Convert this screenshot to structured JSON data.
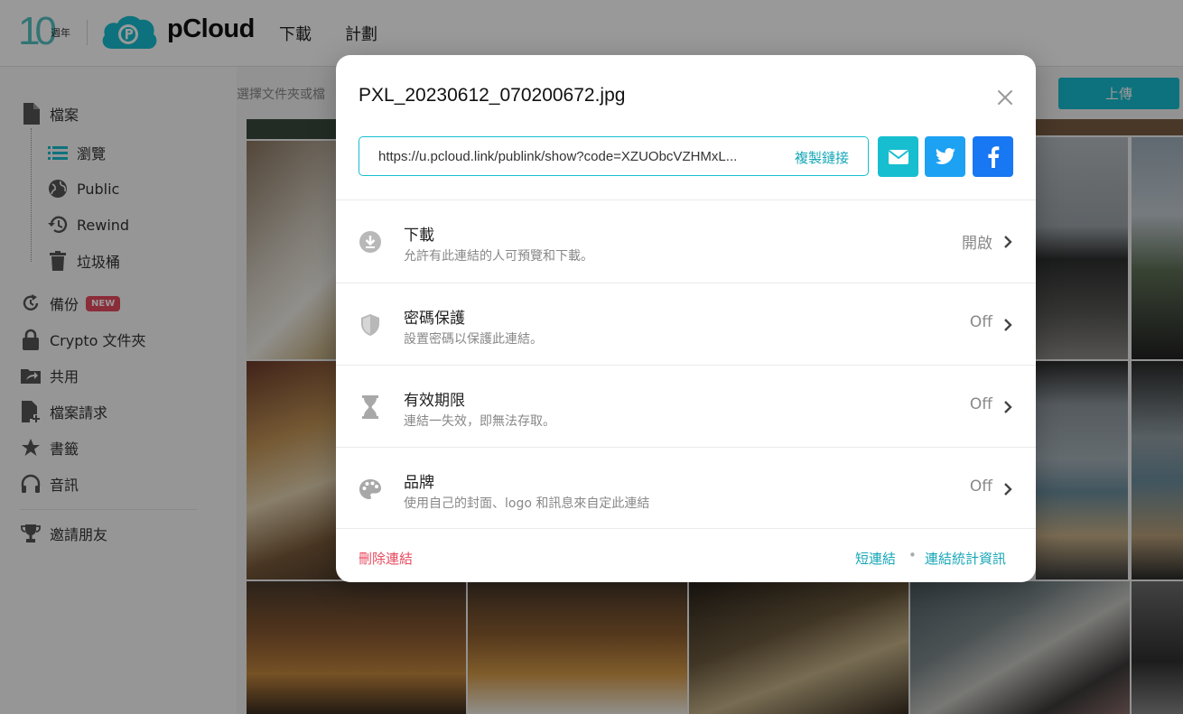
{
  "header": {
    "anniversary_number": "10",
    "anniversary_suffix": "週年",
    "brand": "pCloud",
    "nav": [
      "下載",
      "計劃"
    ]
  },
  "sidebar": {
    "items": [
      {
        "label": "檔案",
        "icon": "file-icon"
      },
      {
        "label": "瀏覽",
        "icon": "list-icon"
      },
      {
        "label": "Public",
        "icon": "globe-icon"
      },
      {
        "label": "Rewind",
        "icon": "history-icon"
      },
      {
        "label": "垃圾桶",
        "icon": "trash-icon"
      },
      {
        "label": "備份",
        "icon": "backup-icon",
        "badge": "NEW"
      },
      {
        "label": "Crypto 文件夾",
        "icon": "lock-icon"
      },
      {
        "label": "共用",
        "icon": "shared-folder-icon"
      },
      {
        "label": "檔案請求",
        "icon": "file-request-icon"
      },
      {
        "label": "書籤",
        "icon": "star-icon"
      },
      {
        "label": "音訊",
        "icon": "headphones-icon"
      },
      {
        "label": "邀請朋友",
        "icon": "trophy-icon"
      }
    ]
  },
  "toolbar": {
    "hint": "選擇文件夾或檔",
    "upload_label": "上傳"
  },
  "modal": {
    "title": "PXL_20230612_070200672.jpg",
    "link_url": "https://u.pcloud.link/publink/show?code=XZUObcVZHMxL...",
    "copy_label": "複製鏈接",
    "share": [
      {
        "name": "email",
        "color": "#17bed0"
      },
      {
        "name": "twitter",
        "color": "#1da1f2"
      },
      {
        "name": "facebook",
        "color": "#1877f2"
      }
    ],
    "rows": [
      {
        "title": "下載",
        "desc": "允許有此連結的人可預覽和下載。",
        "value": "開啟",
        "icon": "download-icon"
      },
      {
        "title": "密碼保護",
        "desc": "設置密碼以保護此連結。",
        "value": "Off",
        "icon": "shield-icon"
      },
      {
        "title": "有效期限",
        "desc": "連結一失效，即無法存取。",
        "value": "Off",
        "icon": "hourglass-icon"
      },
      {
        "title": "品牌",
        "desc": "使用自己的封面、logo 和訊息來自定此連結",
        "value": "Off",
        "icon": "palette-icon"
      }
    ],
    "footer": {
      "delete_label": "刪除連結",
      "short_label": "短連結",
      "separator": "•",
      "stats_label": "連結統計資訊"
    }
  },
  "colors": {
    "accent": "#17bed0",
    "danger": "#e84a5f",
    "twitter": "#1da1f2",
    "facebook": "#1877f2"
  }
}
